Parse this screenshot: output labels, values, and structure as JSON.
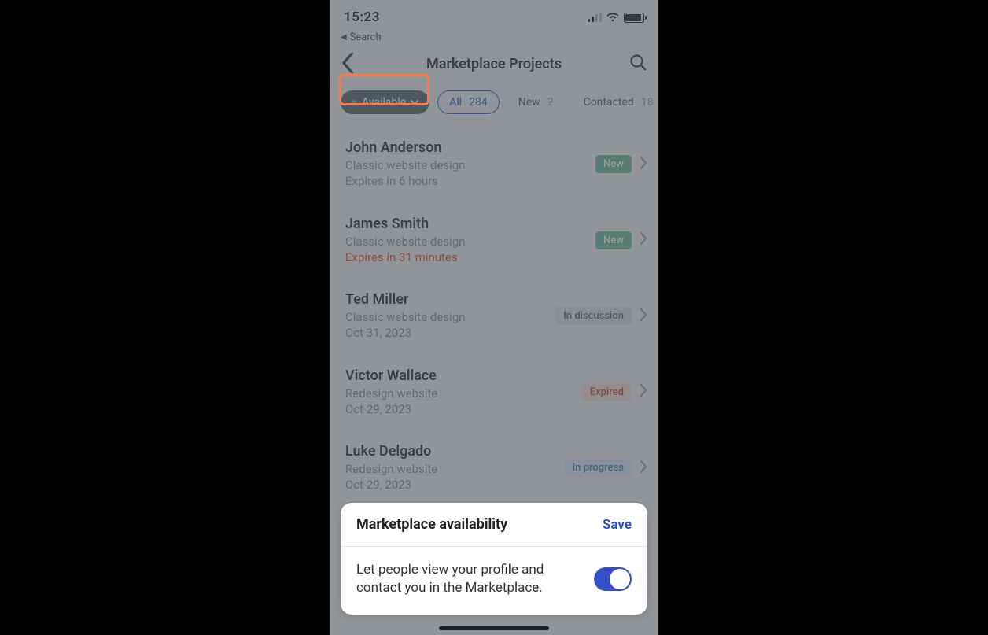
{
  "status": {
    "time": "15:23"
  },
  "back_search": {
    "label": "Search"
  },
  "header": {
    "title": "Marketplace Projects"
  },
  "filters": {
    "availability_label": "Available",
    "all_label": "All",
    "all_count": "284",
    "new_label": "New",
    "new_count": "2",
    "contacted_label": "Contacted",
    "contacted_count": "18",
    "overflow_hint": "I"
  },
  "rows": [
    {
      "name": "John Anderson",
      "sub1": "Classic website design",
      "sub2": "Expires in 6 hours",
      "sub2_warn": false,
      "badge": "New",
      "badge_kind": "new"
    },
    {
      "name": "James Smith",
      "sub1": "Classic website design",
      "sub2": "Expires in 31 minutes",
      "sub2_warn": true,
      "badge": "New",
      "badge_kind": "new"
    },
    {
      "name": "Ted Miller",
      "sub1": "Classic website design",
      "sub2": "Oct 31, 2023",
      "sub2_warn": false,
      "badge": "In discussion",
      "badge_kind": "disc"
    },
    {
      "name": "Victor Wallace",
      "sub1": "Redesign website",
      "sub2": "Oct 29, 2023",
      "sub2_warn": false,
      "badge": "Expired",
      "badge_kind": "exp"
    },
    {
      "name": "Luke Delgado",
      "sub1": "Redesign website",
      "sub2": "Oct 29, 2023",
      "sub2_warn": false,
      "badge": "In progress",
      "badge_kind": "prog"
    }
  ],
  "sheet": {
    "title": "Marketplace availability",
    "save": "Save",
    "text": "Let people view your profile and contact you in the Marketplace.",
    "toggle_on": true
  }
}
